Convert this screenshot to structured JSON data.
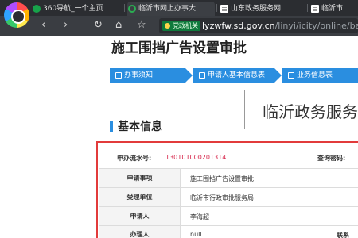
{
  "browser": {
    "tabs": [
      {
        "label": "360导航_一个主页"
      },
      {
        "label": "临沂市网上办事大"
      },
      {
        "label": "山东政务服务网"
      },
      {
        "label": "临沂市"
      }
    ],
    "badge": "党政机关",
    "url_host": "lyzwfw.sd.gov.cn",
    "url_path": "/linyi/icity/online/baseinf"
  },
  "page": {
    "title": "施工围挡广告设置审批",
    "steps": [
      {
        "label": "办事须知"
      },
      {
        "label": "申请人基本信息表"
      },
      {
        "label": "业务信息表"
      }
    ],
    "overlay_text": "临沂政务服务网",
    "section_title": "基本信息",
    "flow_label": "申办流水号:",
    "flow_value": "130101000201314",
    "query_label": "查询密码:",
    "rows": [
      {
        "label": "申请事项",
        "value": "施工围挡广告设置审批"
      },
      {
        "label": "受理单位",
        "value": "临沂市行政审批服务局"
      },
      {
        "label": "申请人",
        "value": "李海超"
      },
      {
        "label": "办理人",
        "value": "null"
      }
    ],
    "partial_label": "联系"
  }
}
